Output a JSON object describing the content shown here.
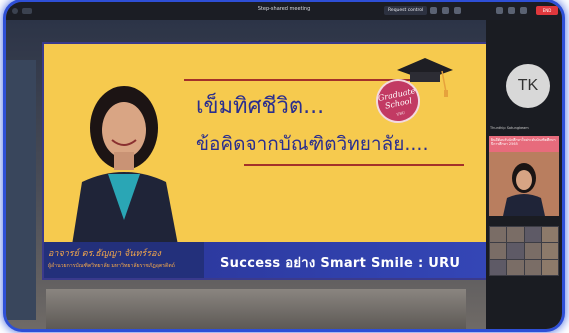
{
  "window": {
    "title": "Step-shared meeting",
    "request_control_label": "Request control",
    "end_label": "END"
  },
  "slide": {
    "headline_line1": "เข็มทิศชีวิต...",
    "headline_line2": "ข้อคิดจากบัณฑิตวิทยาลัย....",
    "badge_line1": "Graduate",
    "badge_line2": "School",
    "badge_small": "URU",
    "presenter_name": "อาจารย์ ดร.ธัญญา จันทร์รอง",
    "presenter_role": "ผู้อำนวยการบัณฑิตวิทยาลัย มหาวิทยาลัยราชภัฏอุตรดิตถ์",
    "tagline": "Success อย่าง Smart Smile : URU",
    "colors": {
      "background": "#f6ca4e",
      "headline": "#2a2e8f",
      "strip": "#23307b",
      "name": "#f4a84b"
    }
  },
  "participants": {
    "tile1_initials": "TK",
    "tile2_label": "Thunthip Sotungkeam",
    "tile2_banner": "ยินดีต้อนรับนักศึกษาใหม่ระดับบัณฑิตศึกษา ปีการศึกษา 2565"
  }
}
